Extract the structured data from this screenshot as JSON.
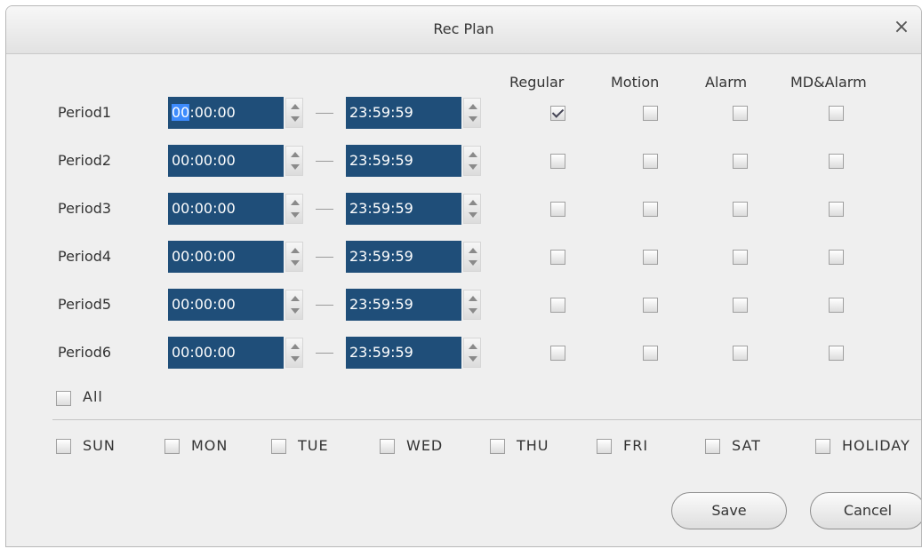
{
  "dialog": {
    "title": "Rec Plan",
    "close_glyph": "×"
  },
  "columns": {
    "regular": "Regular",
    "motion": "Motion",
    "alarm": "Alarm",
    "md_alarm": "MD&Alarm"
  },
  "periods": [
    {
      "label": "Period1",
      "start": "00:00:00",
      "end": "23:59:59",
      "regular": true,
      "motion": false,
      "alarm": false,
      "md_alarm": false
    },
    {
      "label": "Period2",
      "start": "00:00:00",
      "end": "23:59:59",
      "regular": false,
      "motion": false,
      "alarm": false,
      "md_alarm": false
    },
    {
      "label": "Period3",
      "start": "00:00:00",
      "end": "23:59:59",
      "regular": false,
      "motion": false,
      "alarm": false,
      "md_alarm": false
    },
    {
      "label": "Period4",
      "start": "00:00:00",
      "end": "23:59:59",
      "regular": false,
      "motion": false,
      "alarm": false,
      "md_alarm": false
    },
    {
      "label": "Period5",
      "start": "00:00:00",
      "end": "23:59:59",
      "regular": false,
      "motion": false,
      "alarm": false,
      "md_alarm": false
    },
    {
      "label": "Period6",
      "start": "00:00:00",
      "end": "23:59:59",
      "regular": false,
      "motion": false,
      "alarm": false,
      "md_alarm": false
    }
  ],
  "period1_start_selected": "00",
  "period1_start_rest": ":00:00",
  "all_label": "All",
  "days": [
    {
      "label": "SUN"
    },
    {
      "label": "MON"
    },
    {
      "label": "TUE"
    },
    {
      "label": "WED"
    },
    {
      "label": "THU"
    },
    {
      "label": "FRI"
    },
    {
      "label": "SAT"
    },
    {
      "label": "HOLIDAY"
    }
  ],
  "buttons": {
    "save": "Save",
    "cancel": "Cancel"
  }
}
